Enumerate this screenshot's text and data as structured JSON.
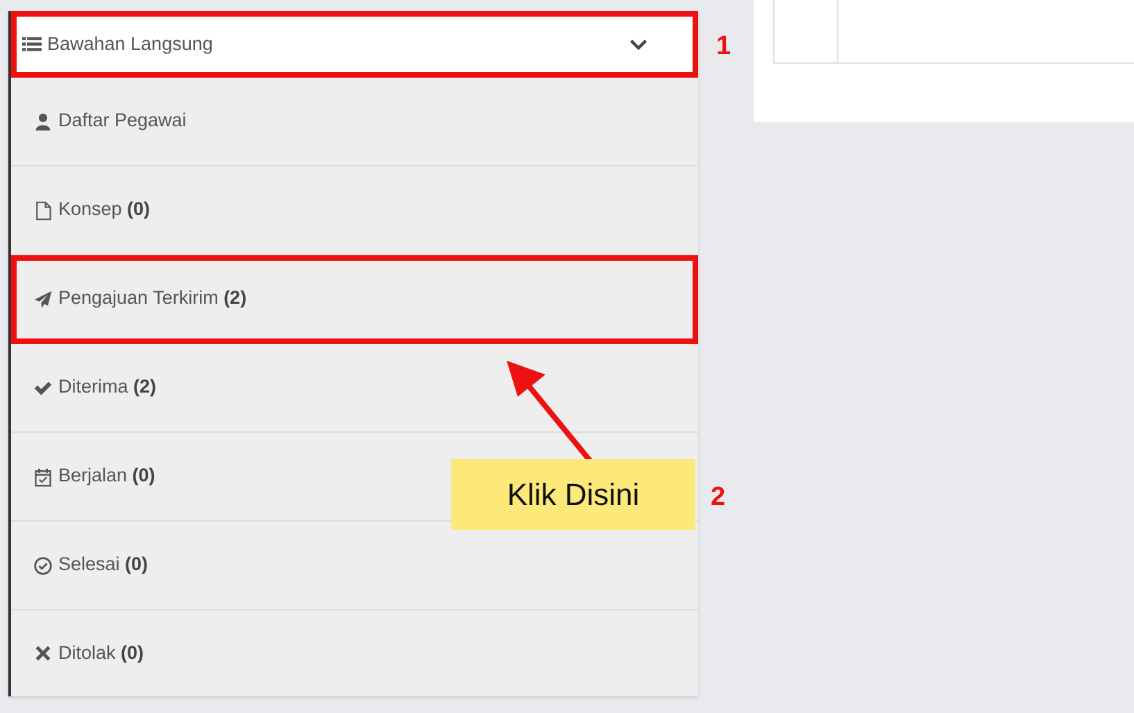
{
  "menu": {
    "header": {
      "label": "Bawahan Langsung",
      "expanded": true,
      "highlighted": true,
      "marker": "1"
    },
    "items": [
      {
        "kind": "user",
        "label": "Daftar Pegawai",
        "highlighted": false
      },
      {
        "kind": "file",
        "label": "Konsep **(0)**",
        "highlighted": false
      },
      {
        "kind": "send",
        "label": "Pengajuan Terkirim **(2)**",
        "highlighted": true
      },
      {
        "kind": "check",
        "label": "Diterima **(2)**",
        "highlighted": false
      },
      {
        "kind": "calendar",
        "label": "Berjalan **(0)**",
        "highlighted": false
      },
      {
        "kind": "done",
        "label": "Selesai **(0)**",
        "highlighted": false
      },
      {
        "kind": "rejected",
        "label": "Ditolak **(0)**",
        "highlighted": false
      }
    ]
  },
  "note": {
    "text": "Klik Disini",
    "marker": "2"
  }
}
